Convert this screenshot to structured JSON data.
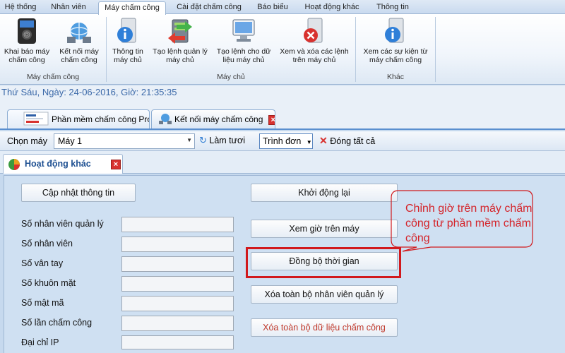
{
  "menu_tabs": [
    "Hệ thống",
    "Nhân viên",
    "Máy chấm công",
    "Cài đặt chấm công",
    "Báo biểu",
    "Hoạt động khác",
    "Thông tin"
  ],
  "ribbon": {
    "buttons": [
      {
        "line1": "Khai báo máy",
        "line2": "chấm công",
        "icon": "fingerprint-device-icon"
      },
      {
        "line1": "Kết nối máy",
        "line2": "chấm công",
        "icon": "network-connect-icon"
      },
      {
        "line1": "Thông tin",
        "line2": "máy chủ",
        "icon": "server-info-icon"
      },
      {
        "line1": "Tạo lệnh quản lý",
        "line2": "máy chủ",
        "icon": "server-command-icon"
      },
      {
        "line1": "Tạo lệnh cho dữ",
        "line2": "liệu máy chủ",
        "icon": "data-command-icon"
      },
      {
        "line1": "Xem và xóa các lệnh",
        "line2": "trên máy chủ",
        "icon": "delete-command-icon"
      },
      {
        "line1": "Xem các sự kiện từ",
        "line2": "máy chấm công",
        "icon": "event-info-icon"
      }
    ],
    "groups": [
      "Máy chấm công",
      "Máy chủ",
      "Khác"
    ]
  },
  "status_datetime": "Thứ Sáu, Ngày: 24-06-2016, Giờ: 21:35:35",
  "doc_tabs": [
    {
      "label": "Phần mềm chấm công Pro"
    },
    {
      "label": "Kết nối máy chấm công"
    }
  ],
  "toolbar": {
    "choose_label": "Chọn máy",
    "machine_value": "Máy 1",
    "refresh_label": "Làm tươi",
    "menu_label": "Trình đơn",
    "close_all_label": "Đóng tất cả"
  },
  "inner_tab_label": "Hoạt động khác",
  "left_button": "Cập nhật thông tin",
  "fields": [
    {
      "label": "Số nhân viên quản lý",
      "value": ""
    },
    {
      "label": "Số nhân viên",
      "value": ""
    },
    {
      "label": "Số vân tay",
      "value": ""
    },
    {
      "label": "Số khuôn mặt",
      "value": ""
    },
    {
      "label": "Số mật mã",
      "value": ""
    },
    {
      "label": "Số lần chấm công",
      "value": ""
    },
    {
      "label": "Đại chỉ IP",
      "value": ""
    }
  ],
  "right_buttons": [
    {
      "label": "Khởi động lại"
    },
    {
      "label": "Xem giờ trên máy"
    },
    {
      "label": "Đồng bộ thời gian"
    },
    {
      "label": "Xóa toàn bộ nhân viên quản lý"
    },
    {
      "label": "Xóa toàn bộ dữ liệu chấm công"
    }
  ],
  "callout_text": "Chỉnh giờ trên máy chấm công từ phần mềm chấm công",
  "colors": {
    "accent": "#3a68a8",
    "highlight": "#d1191d",
    "danger_text": "#c0392b"
  }
}
